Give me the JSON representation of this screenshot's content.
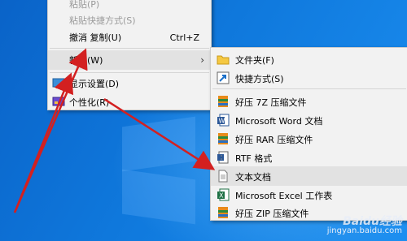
{
  "context_menu": {
    "items": [
      {
        "label": "粘贴(P)",
        "shortcut": "",
        "disabled": true
      },
      {
        "label": "粘贴快捷方式(S)",
        "shortcut": "",
        "disabled": true
      },
      {
        "label": "撤消 复制(U)",
        "shortcut": "Ctrl+Z",
        "disabled": false
      },
      {
        "label": "新建(W)",
        "shortcut": "",
        "disabled": false,
        "has_submenu": true,
        "highlighted": true
      },
      {
        "label": "显示设置(D)",
        "icon": "display-settings-icon"
      },
      {
        "label": "个性化(R)",
        "icon": "personalize-icon"
      }
    ]
  },
  "submenu": {
    "items": [
      {
        "label": "文件夹(F)",
        "icon": "folder-icon"
      },
      {
        "label": "快捷方式(S)",
        "icon": "shortcut-icon"
      },
      {
        "label": "好压 7Z 压缩文件",
        "icon": "haozip-archive-icon"
      },
      {
        "label": "Microsoft Word 文档",
        "icon": "word-doc-icon"
      },
      {
        "label": "好压 RAR 压缩文件",
        "icon": "haozip-archive-icon"
      },
      {
        "label": "RTF 格式",
        "icon": "rtf-doc-icon"
      },
      {
        "label": "文本文档",
        "icon": "text-doc-icon",
        "highlighted": true
      },
      {
        "label": "Microsoft Excel 工作表",
        "icon": "excel-sheet-icon"
      },
      {
        "label": "好压 ZIP 压缩文件",
        "icon": "haozip-archive-icon"
      }
    ]
  },
  "watermark": {
    "logo": "Baidu经验",
    "url": "jingyan.baidu.com"
  },
  "colors": {
    "annotation_arrow": "#d32020",
    "desktop": "#0f78dc",
    "menu_bg": "#f2f2f2"
  }
}
